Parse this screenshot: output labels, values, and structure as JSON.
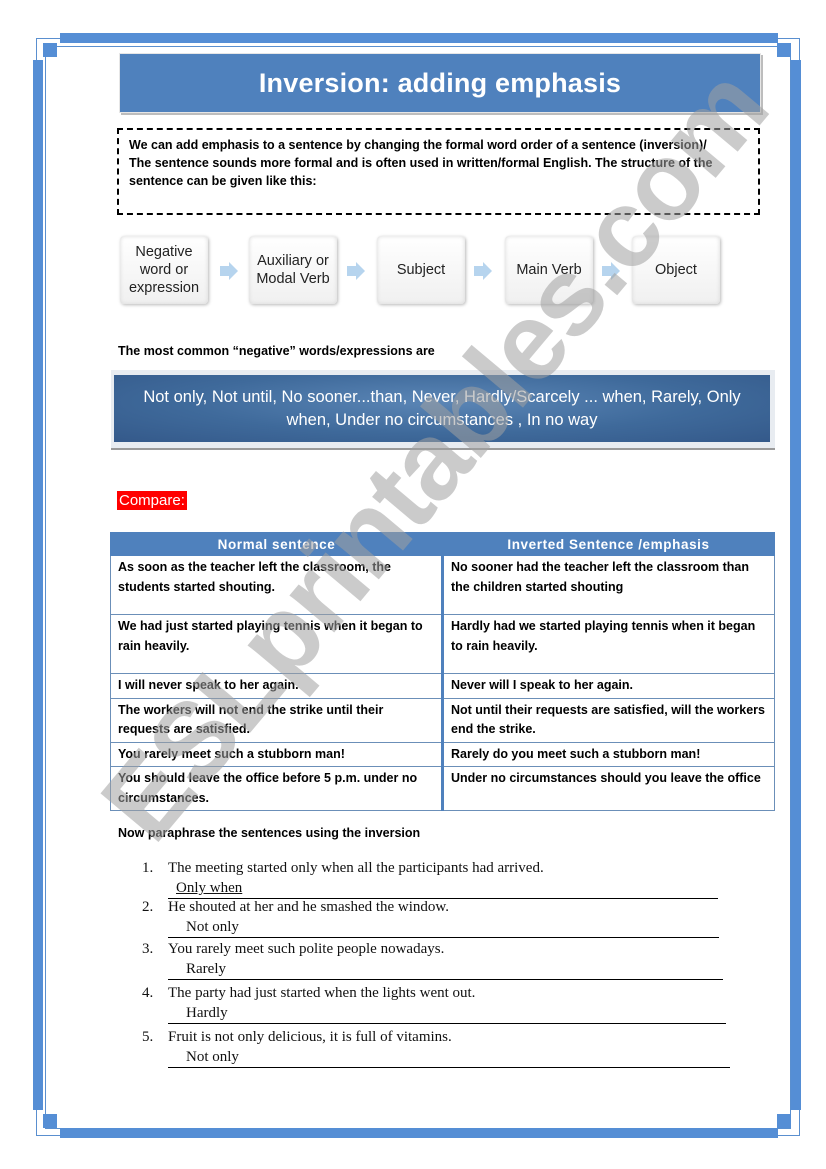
{
  "title": "Inversion: adding emphasis",
  "intro": {
    "line1": "We can add emphasis to a sentence by changing the formal word order of a sentence (inversion)/",
    "line2": "The sentence sounds more formal and is often used in written/formal English. The structure of the sentence can be given like this:"
  },
  "flow": {
    "steps": [
      "Negative word or expression",
      "Auxiliary or Modal Verb",
      "Subject",
      "Main Verb",
      "Object"
    ],
    "arrow_icon": "right-arrow-icon"
  },
  "negative_words": {
    "heading": "The most common “negative” words/expressions are",
    "list": "Not only, Not until, No sooner...than, Never, Hardly/Scarcely ... when, Rarely, Only when, Under no circumstances , In no way"
  },
  "compare": {
    "label": "Compare:",
    "headers": [
      "Normal  sentence",
      "Inverted Sentence /emphasis"
    ],
    "rows": [
      {
        "normal": "As soon as the teacher left the classroom, the students started shouting.",
        "inverted": "No sooner had the teacher left the classroom than the children started shouting"
      },
      {
        "normal": "We had just started playing tennis when it began to rain heavily.",
        "inverted": "Hardly had we started playing tennis when it began to rain heavily."
      },
      {
        "normal": "I will never  speak to her again.",
        "inverted": "Never will I speak to her again."
      },
      {
        "normal": "The workers will not end the strike until their requests are satisfied.",
        "inverted": "Not until their requests are satisfied, will the workers end the strike."
      },
      {
        "normal": "You rarely meet such a stubborn man!",
        "inverted": "Rarely do you meet such a stubborn man!"
      },
      {
        "normal": "You should leave the office before 5 p.m. under no circumstances.",
        "inverted": "Under no circumstances should you leave the office"
      }
    ]
  },
  "exercise": {
    "heading": "Now paraphrase the sentences using the inversion",
    "items": [
      {
        "num": "1.",
        "sentence": "The meeting started only when all the participants had arrived.",
        "prompt": "Only when"
      },
      {
        "num": "2.",
        "sentence": "He shouted at her and he smashed the window.",
        "prompt": "Not only"
      },
      {
        "num": "3.",
        "sentence": "You rarely meet such polite people nowadays.",
        "prompt": "Rarely"
      },
      {
        "num": "4.",
        "sentence": "The party had just started when the lights went out.",
        "prompt": "Hardly"
      },
      {
        "num": "5.",
        "sentence": "Fruit is not only delicious, it is full of vitamins.",
        "prompt": "Not only"
      }
    ]
  },
  "watermark": "ESLprintables.com",
  "colors": {
    "frame": "#558ed5",
    "title_bg": "#4f81bd",
    "banner_bg": "#3f6a9b",
    "compare_label_bg": "#ff0000",
    "arrow": "#b6d4ee"
  }
}
